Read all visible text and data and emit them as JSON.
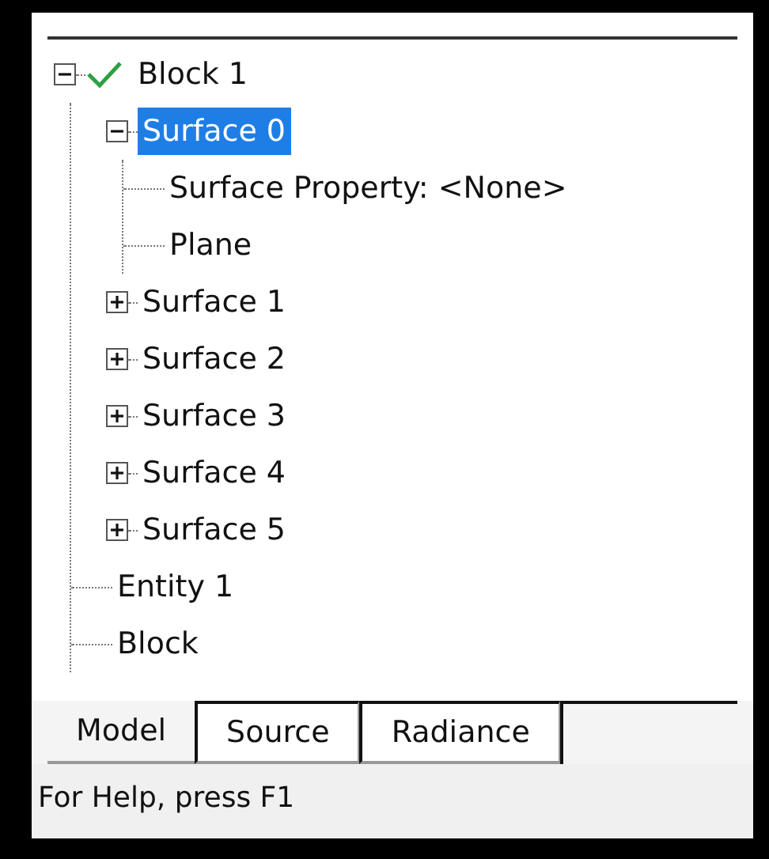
{
  "tree": [
    {
      "label": "Block 1",
      "expanded": true,
      "selected": false,
      "checked": true,
      "children": [
        {
          "label": "Surface 0",
          "expanded": true,
          "selected": true,
          "children": [
            {
              "label": "Surface Property: <None>",
              "selected": false
            },
            {
              "label": "Plane",
              "selected": false
            }
          ]
        },
        {
          "label": "Surface 1",
          "expanded": false,
          "selected": false
        },
        {
          "label": "Surface 2",
          "expanded": false,
          "selected": false
        },
        {
          "label": "Surface 3",
          "expanded": false,
          "selected": false
        },
        {
          "label": "Surface 4",
          "expanded": false,
          "selected": false
        },
        {
          "label": "Surface 5",
          "expanded": false,
          "selected": false
        },
        {
          "label": "Entity 1",
          "selected": false
        },
        {
          "label": "Block",
          "selected": false
        }
      ]
    }
  ],
  "tabs": [
    {
      "label": "Model",
      "selected": true
    },
    {
      "label": "Source",
      "selected": false
    },
    {
      "label": "Radiance",
      "selected": false
    }
  ],
  "status_bar": "For Help, press F1"
}
